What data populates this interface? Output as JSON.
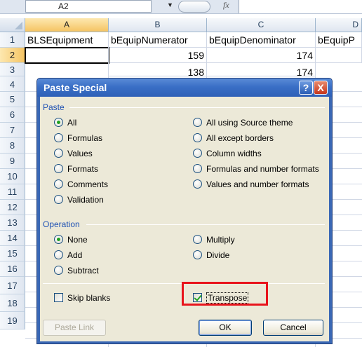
{
  "formula_bar": {
    "name_box": "A2",
    "fx_label": "fx",
    "formula": ""
  },
  "columns": [
    "A",
    "B",
    "C",
    "D"
  ],
  "rows": [
    "1",
    "2",
    "3",
    "4",
    "5",
    "6",
    "7",
    "8",
    "9",
    "10",
    "11",
    "12",
    "13",
    "14",
    "15",
    "16",
    "17",
    "18",
    "19"
  ],
  "row1": {
    "a": "BLSEquipment",
    "b": "bEquipNumerator",
    "c": "bEquipDenominator",
    "d": "bEquipP"
  },
  "row2": {
    "b": "159",
    "c": "174"
  },
  "row3": {
    "b": "138",
    "c": "174"
  },
  "dialog": {
    "title": "Paste Special",
    "help_btn": "?",
    "close_btn": "X",
    "paste_section": "Paste",
    "paste_options": {
      "all": "All",
      "formulas": "Formulas",
      "values": "Values",
      "formats": "Formats",
      "comments": "Comments",
      "validation": "Validation",
      "all_source_theme": "All using Source theme",
      "all_except_borders": "All except borders",
      "column_widths": "Column widths",
      "formulas_number_formats": "Formulas and number formats",
      "values_number_formats": "Values and number formats"
    },
    "paste_selected": "All",
    "operation_section": "Operation",
    "operation_options": {
      "none": "None",
      "add": "Add",
      "subtract": "Subtract",
      "multiply": "Multiply",
      "divide": "Divide"
    },
    "operation_selected": "None",
    "skip_blanks": "Skip blanks",
    "skip_blanks_checked": false,
    "transpose": "Transpose",
    "transpose_checked": true,
    "paste_link": "Paste Link",
    "ok": "OK",
    "cancel": "Cancel",
    "highlight_color": "#e8141c"
  }
}
